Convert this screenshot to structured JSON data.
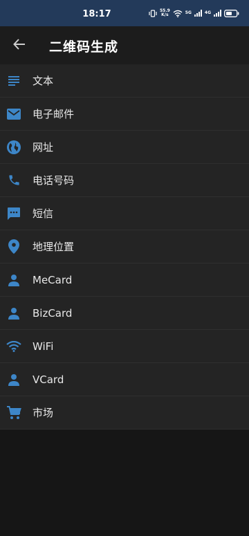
{
  "status_bar": {
    "time": "18:17",
    "net_speed_value": "55.9",
    "net_speed_unit": "K/s",
    "network_5g": "5G",
    "network_4g": "4G"
  },
  "app_bar": {
    "title": "二维码生成",
    "back_icon": "arrow-back-icon"
  },
  "colors": {
    "accent": "#3d86c8",
    "status_bar_bg": "#233a5a",
    "list_bg": "#242424",
    "page_bg": "#161616"
  },
  "items": [
    {
      "label": "文本",
      "icon": "text-icon"
    },
    {
      "label": "电子邮件",
      "icon": "email-icon"
    },
    {
      "label": "网址",
      "icon": "globe-icon"
    },
    {
      "label": "电话号码",
      "icon": "phone-icon"
    },
    {
      "label": "短信",
      "icon": "sms-icon"
    },
    {
      "label": "地理位置",
      "icon": "location-icon"
    },
    {
      "label": "MeCard",
      "icon": "person-icon"
    },
    {
      "label": "BizCard",
      "icon": "person-icon"
    },
    {
      "label": "WiFi",
      "icon": "wifi-icon"
    },
    {
      "label": "VCard",
      "icon": "person-icon"
    },
    {
      "label": "市场",
      "icon": "cart-icon"
    }
  ]
}
